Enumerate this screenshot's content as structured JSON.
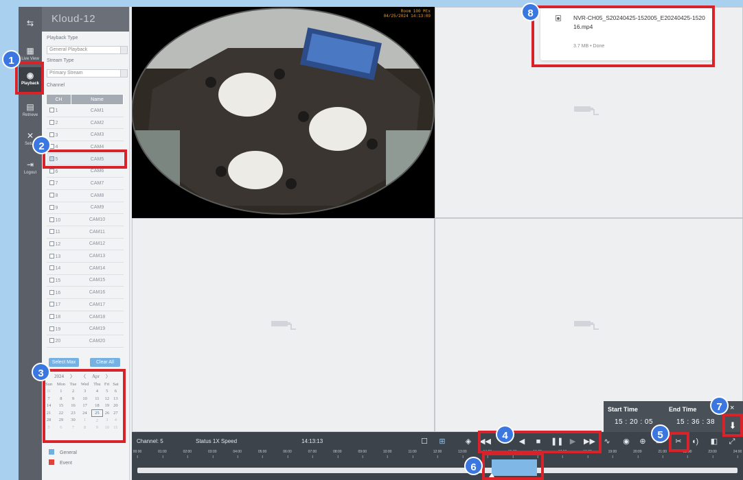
{
  "nav": {
    "items": [
      {
        "label": "Live View",
        "icon": "live-view-icon"
      },
      {
        "label": "Playback",
        "icon": "playback-icon"
      },
      {
        "label": "Retrieve",
        "icon": "retrieve-icon"
      },
      {
        "label": "Setup",
        "icon": "wrench-icon"
      },
      {
        "label": "Logout",
        "icon": "logout-icon"
      }
    ]
  },
  "panel": {
    "logo": "Kloud-12",
    "playback_type_label": "Playback Type",
    "playback_type_value": "General Playback",
    "stream_type_label": "Stream Type",
    "stream_type_value": "Primary Stream",
    "channel_label": "Channel",
    "table_headers": [
      "CH",
      "Name"
    ],
    "channels": [
      {
        "ch": "1",
        "name": "CAM1"
      },
      {
        "ch": "2",
        "name": "CAM2"
      },
      {
        "ch": "3",
        "name": "CAM3"
      },
      {
        "ch": "4",
        "name": "CAM4"
      },
      {
        "ch": "5",
        "name": "CAM5"
      },
      {
        "ch": "6",
        "name": "CAM6"
      },
      {
        "ch": "7",
        "name": "CAM7"
      },
      {
        "ch": "8",
        "name": "CAM8"
      },
      {
        "ch": "9",
        "name": "CAM9"
      },
      {
        "ch": "10",
        "name": "CAM10"
      },
      {
        "ch": "11",
        "name": "CAM11"
      },
      {
        "ch": "12",
        "name": "CAM12"
      },
      {
        "ch": "13",
        "name": "CAM13"
      },
      {
        "ch": "14",
        "name": "CAM14"
      },
      {
        "ch": "15",
        "name": "CAM15"
      },
      {
        "ch": "16",
        "name": "CAM16"
      },
      {
        "ch": "17",
        "name": "CAM17"
      },
      {
        "ch": "18",
        "name": "CAM18"
      },
      {
        "ch": "19",
        "name": "CAM19"
      },
      {
        "ch": "20",
        "name": "CAM20"
      }
    ],
    "selected_channel": "5",
    "select_max_label": "Select Max",
    "clear_all_label": "Clear All"
  },
  "calendar": {
    "year": "2024",
    "month": "Apr",
    "weekdays": [
      "Sun",
      "Mon",
      "Tue",
      "Wed",
      "Thu",
      "Fri",
      "Sat"
    ],
    "weeks": [
      [
        "31",
        "1",
        "2",
        "3",
        "4",
        "5",
        "6"
      ],
      [
        "7",
        "8",
        "9",
        "10",
        "11",
        "12",
        "13"
      ],
      [
        "14",
        "15",
        "16",
        "17",
        "18",
        "19",
        "20"
      ],
      [
        "21",
        "22",
        "23",
        "24",
        "25",
        "26",
        "27"
      ],
      [
        "28",
        "29",
        "30",
        "1",
        "2",
        "3",
        "4"
      ],
      [
        "5",
        "6",
        "7",
        "8",
        "9",
        "10",
        "11"
      ]
    ],
    "today": "25"
  },
  "legend": [
    {
      "label": "General",
      "color": "#6fb0e0"
    },
    {
      "label": "Event",
      "color": "#e2413a"
    }
  ],
  "video": {
    "osd_title": "Room 100 Mtx",
    "osd_time": "04/25/2024 14:13:09"
  },
  "download": {
    "filename": "NVR-CH05_S20240425-152005_E20240425-152016.mp4",
    "meta": "3.7 MB • Done"
  },
  "clip": {
    "start_label": "Start Time",
    "end_label": "End Time",
    "start_time": "15 : 20 : 05",
    "end_time": "15 : 36 : 38",
    "close": "×"
  },
  "controls": {
    "channel": "Channel: 5",
    "status": "Status 1X Speed",
    "time": "14:13:13",
    "ticks": [
      "00:00",
      "01:00",
      "02:00",
      "03:00",
      "04:00",
      "05:00",
      "06:00",
      "07:00",
      "08:00",
      "09:00",
      "10:00",
      "11:00",
      "12:00",
      "13:00",
      "14:00",
      "15:00",
      "16:00",
      "17:00",
      "18:00",
      "19:00",
      "20:00",
      "21:00",
      "22:00",
      "23:00",
      "24:00"
    ],
    "colors": {
      "bar": "#3d434b",
      "segment": "#7fb8e6"
    }
  },
  "annotations": [
    "1",
    "2",
    "3",
    "4",
    "5",
    "6",
    "7",
    "8"
  ]
}
